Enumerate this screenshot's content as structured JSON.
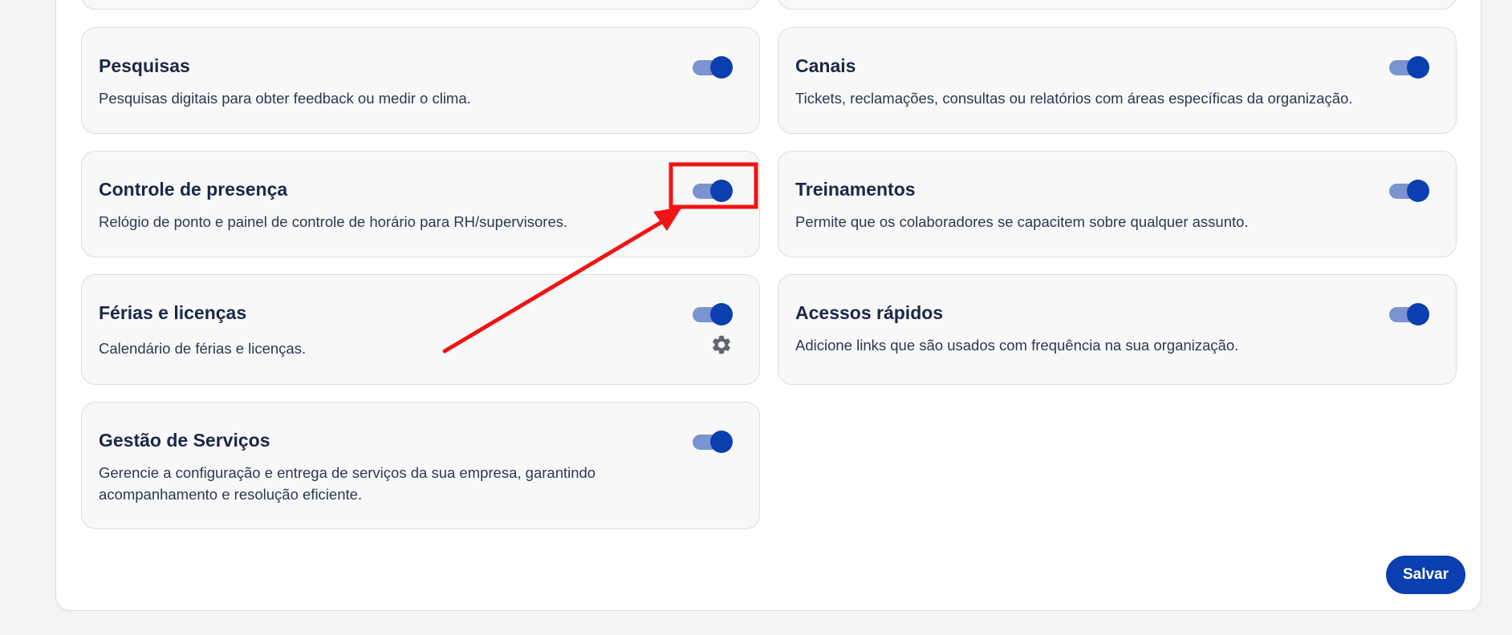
{
  "cards": [
    {
      "title": "Pesquisas",
      "description": "Pesquisas digitais para obter feedback ou medir o clima.",
      "enabled": true
    },
    {
      "title": "Canais",
      "description": "Tickets, reclamações, consultas ou relatórios com áreas específicas da organização.",
      "enabled": true
    },
    {
      "title": "Controle de presença",
      "description": "Relógio de ponto e painel de controle de horário para RH/supervisores.",
      "enabled": true
    },
    {
      "title": "Treinamentos",
      "description": "Permite que os colaboradores se capacitem sobre qualquer assunto.",
      "enabled": true
    },
    {
      "title": "Férias e licenças",
      "description": "Calendário de férias e licenças.",
      "enabled": true,
      "icon": "gear-icon"
    },
    {
      "title": "Acessos rápidos",
      "description": "Adicione links que são usados com frequência na sua organização.",
      "enabled": true
    },
    {
      "title": "Gestão de Serviços",
      "description": "Gerencie a configuração e entrega de serviços da sua empresa, garantindo acompanhamento e resolução eficiente.",
      "enabled": true
    }
  ],
  "save_label": "Salvar",
  "colors": {
    "accent": "#0b3fb0",
    "toggle_track": "#7b93d0",
    "annotation": "#f01414"
  }
}
